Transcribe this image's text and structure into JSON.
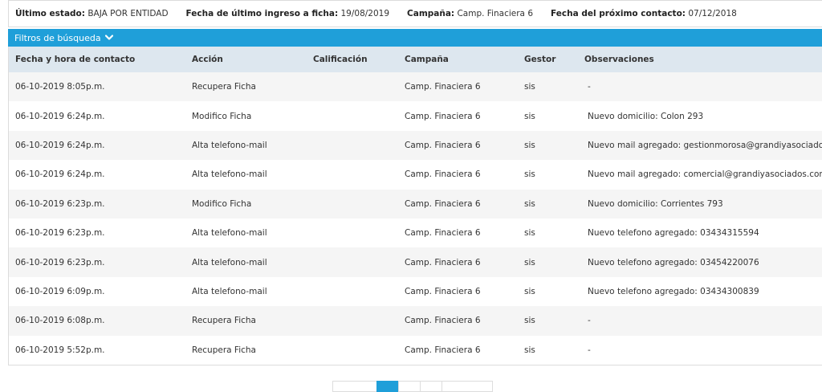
{
  "status": {
    "estado_label": "Último estado:",
    "estado_value": "BAJA POR ENTIDAD",
    "ingreso_label": "Fecha de último ingreso a ficha:",
    "ingreso_value": "19/08/2019",
    "campana_label": "Campaña:",
    "campana_value": "Camp. Finaciera 6",
    "contacto_label": "Fecha del próximo contacto:",
    "contacto_value": "07/12/2018"
  },
  "filters": {
    "label": "Filtros de búsqueda",
    "icon": "chevron-down-icon"
  },
  "table": {
    "headers": [
      "Fecha y hora de contacto",
      "Acción",
      "Calificación",
      "Campaña",
      "Gestor",
      "Observaciones"
    ],
    "rows": [
      [
        "06-10-2019 8:05p.m.",
        "Recupera Ficha",
        "",
        "Camp. Finaciera 6",
        "sis",
        "-"
      ],
      [
        "06-10-2019 6:24p.m.",
        "Modifico Ficha",
        "",
        "Camp. Finaciera 6",
        "sis",
        "Nuevo domicilio: Colon 293"
      ],
      [
        "06-10-2019 6:24p.m.",
        "Alta telefono-mail",
        "",
        "Camp. Finaciera 6",
        "sis",
        "Nuevo mail agregado: gestionmorosa@grandiyasociados.com"
      ],
      [
        "06-10-2019 6:24p.m.",
        "Alta telefono-mail",
        "",
        "Camp. Finaciera 6",
        "sis",
        "Nuevo mail agregado: comercial@grandiyasociados.com"
      ],
      [
        "06-10-2019 6:23p.m.",
        "Modifico Ficha",
        "",
        "Camp. Finaciera 6",
        "sis",
        "Nuevo domicilio: Corrientes 793"
      ],
      [
        "06-10-2019 6:23p.m.",
        "Alta telefono-mail",
        "",
        "Camp. Finaciera 6",
        "sis",
        "Nuevo telefono agregado: 03434315594"
      ],
      [
        "06-10-2019 6:23p.m.",
        "Alta telefono-mail",
        "",
        "Camp. Finaciera 6",
        "sis",
        "Nuevo telefono agregado: 03454220076"
      ],
      [
        "06-10-2019 6:09p.m.",
        "Alta telefono-mail",
        "",
        "Camp. Finaciera 6",
        "sis",
        "Nuevo telefono agregado: 03434300839"
      ],
      [
        "06-10-2019 6:08p.m.",
        "Recupera Ficha",
        "",
        "Camp. Finaciera 6",
        "sis",
        "-"
      ],
      [
        "06-10-2019 5:52p.m.",
        "Recupera Ficha",
        "",
        "Camp. Finaciera 6",
        "sis",
        "-"
      ]
    ]
  },
  "colors": {
    "accent": "#1f9fd9",
    "header_bg": "#dde7ef",
    "row_alt": "#f5f5f5"
  }
}
